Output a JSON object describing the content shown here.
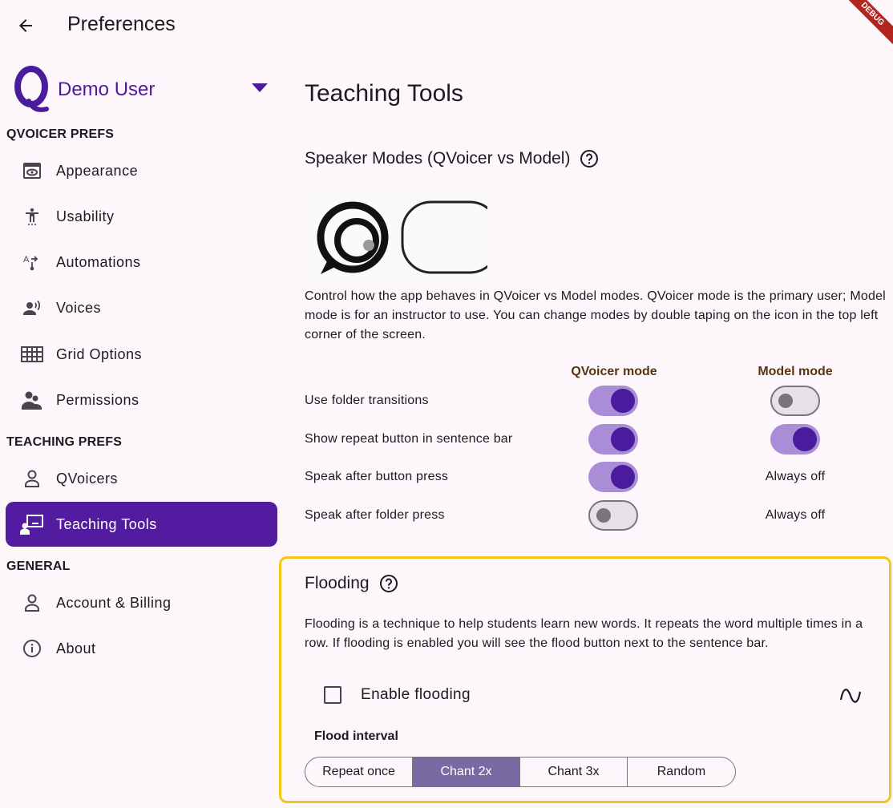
{
  "appbar": {
    "title": "Preferences",
    "debug_label": "DEBUG"
  },
  "sidebar": {
    "user_name": "Demo User",
    "sections": {
      "qvoicer_prefs": "QVOICER PREFS",
      "teaching_prefs": "TEACHING PREFS",
      "general": "GENERAL"
    },
    "items": [
      {
        "label": "Appearance",
        "icon": "appearance-icon"
      },
      {
        "label": "Usability",
        "icon": "accessibility-icon"
      },
      {
        "label": "Automations",
        "icon": "automation-icon"
      },
      {
        "label": "Voices",
        "icon": "voice-icon"
      },
      {
        "label": "Grid Options",
        "icon": "grid-icon"
      },
      {
        "label": "Permissions",
        "icon": "people-icon"
      },
      {
        "label": "QVoicers",
        "icon": "person-icon"
      },
      {
        "label": "Teaching Tools",
        "icon": "teacher-icon",
        "active": true
      },
      {
        "label": "Account & Billing",
        "icon": "person-icon"
      },
      {
        "label": "About",
        "icon": "info-icon"
      }
    ]
  },
  "main": {
    "title": "Teaching Tools",
    "speaker_modes": {
      "title": "Speaker Modes (QVoicer vs Model)",
      "description": "Control how the app behaves in QVoicer vs Model modes. QVoicer mode is the primary user; Model mode is for an instructor to use. You can change modes by double taping on the icon in the top left corner of the screen.",
      "col_qvoicer": "QVoicer mode",
      "col_model": "Model mode",
      "rows": [
        {
          "label": "Use folder transitions",
          "qvoicer": true,
          "model": false
        },
        {
          "label": "Show repeat button in sentence bar",
          "qvoicer": true,
          "model": true
        },
        {
          "label": "Speak after button press",
          "qvoicer": true,
          "model_text": "Always off"
        },
        {
          "label": "Speak after folder press",
          "qvoicer": false,
          "model_text": "Always off"
        }
      ]
    },
    "flooding": {
      "title": "Flooding",
      "description": "Flooding is a technique to help students learn new words. It repeats the word multiple times in a row. If flooding is enabled you will see the flood button next to the sentence bar.",
      "enable_label": "Enable flooding",
      "enabled": false,
      "interval_label": "Flood interval",
      "options": [
        "Repeat once",
        "Chant 2x",
        "Chant 3x",
        "Random"
      ],
      "selected": "Chant 2x"
    }
  },
  "colors": {
    "accent": "#531ca0",
    "brand": "#4a1b9c",
    "highlight_border": "#f5c518",
    "segment_selected": "#7a6aa3"
  }
}
